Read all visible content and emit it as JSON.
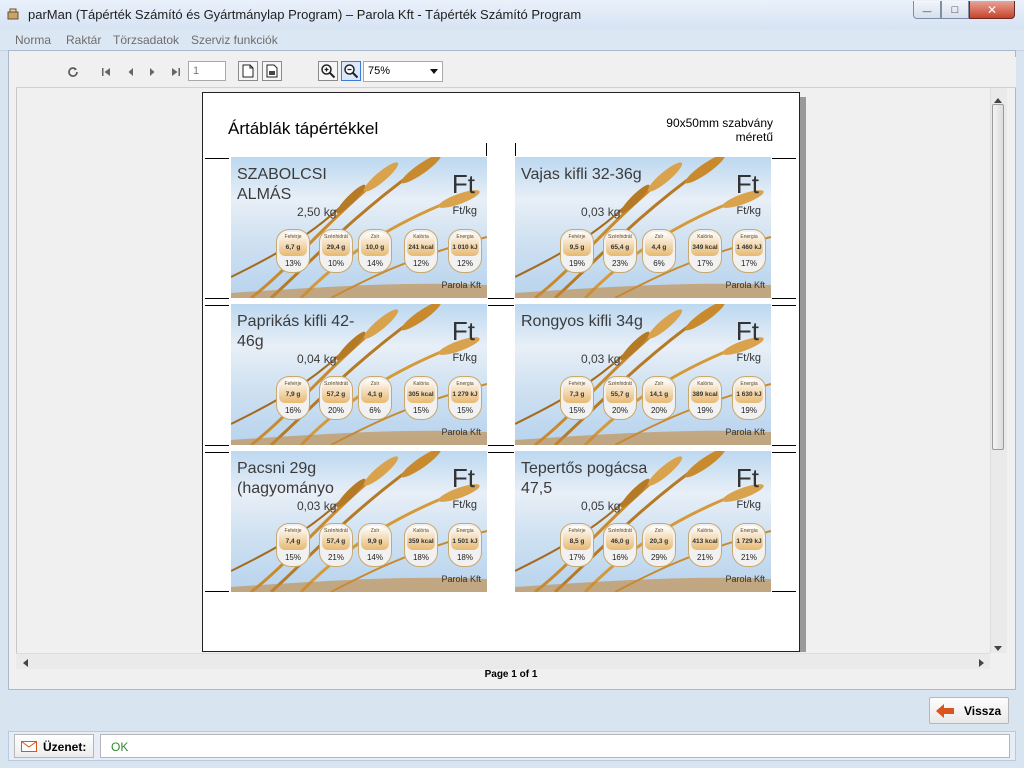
{
  "window": {
    "title": "parMan (Tápérték Számító és Gyártmánylap Program)    –    Parola Kft - Tápérték Számító Program",
    "minimize_glyph": "—",
    "maximize_glyph": "□",
    "close_glyph": "✕"
  },
  "menu": [
    "Norma",
    "Raktár",
    "Törzsadatok",
    "Szerviz funkciók"
  ],
  "toolbar": {
    "refresh_icon": "refresh-icon",
    "first_icon": "first-page-icon",
    "prev_icon": "prev-page-icon",
    "next_icon": "next-page-icon",
    "last_icon": "last-page-icon",
    "page_input": "1",
    "zoom_value": "75%"
  },
  "report": {
    "title": "Ártáblák tápértékkel",
    "note": "90x50mm szabvány méretű",
    "status": "Page 1 of 1"
  },
  "labels": [
    {
      "name": "SZABOLCSI ALMÁS",
      "price": "2,50  kg",
      "ft": "Ft",
      "ftkg": "Ft/kg",
      "firm": "Parola Kft",
      "nutrients": [
        {
          "label": "Fehérje",
          "value": "6,7 g",
          "pct": "13%"
        },
        {
          "label": "Szénhidrát",
          "value": "29,4 g",
          "pct": "10%"
        },
        {
          "label": "Zsír",
          "value": "10,0 g",
          "pct": "14%"
        },
        {
          "label": "Kalória",
          "value": "241 kcal",
          "pct": "12%"
        },
        {
          "label": "Energia",
          "value": "1 010 kJ",
          "pct": "12%"
        }
      ]
    },
    {
      "name": "Vajas kifli 32-36g",
      "price": "0,03  kg",
      "ft": "Ft",
      "ftkg": "Ft/kg",
      "firm": "Parola Kft",
      "nutrients": [
        {
          "label": "Fehérje",
          "value": "9,5 g",
          "pct": "19%"
        },
        {
          "label": "Szénhidrát",
          "value": "65,4 g",
          "pct": "23%"
        },
        {
          "label": "Zsír",
          "value": "4,4 g",
          "pct": "6%"
        },
        {
          "label": "Kalória",
          "value": "349 kcal",
          "pct": "17%"
        },
        {
          "label": "Energia",
          "value": "1 460 kJ",
          "pct": "17%"
        }
      ]
    },
    {
      "name": "Paprikás kifli 42-46g",
      "price": "0,04  kg",
      "ft": "Ft",
      "ftkg": "Ft/kg",
      "firm": "Parola Kft",
      "nutrients": [
        {
          "label": "Fehérje",
          "value": "7,9 g",
          "pct": "16%"
        },
        {
          "label": "Szénhidrát",
          "value": "57,2 g",
          "pct": "20%"
        },
        {
          "label": "Zsír",
          "value": "4,1 g",
          "pct": "6%"
        },
        {
          "label": "Kalória",
          "value": "305 kcal",
          "pct": "15%"
        },
        {
          "label": "Energia",
          "value": "1 279 kJ",
          "pct": "15%"
        }
      ]
    },
    {
      "name": "Rongyos kifli 34g",
      "price": "0,03  kg",
      "ft": "Ft",
      "ftkg": "Ft/kg",
      "firm": "Parola Kft",
      "nutrients": [
        {
          "label": "Fehérje",
          "value": "7,3 g",
          "pct": "15%"
        },
        {
          "label": "Szénhidrát",
          "value": "55,7 g",
          "pct": "20%"
        },
        {
          "label": "Zsír",
          "value": "14,1 g",
          "pct": "20%"
        },
        {
          "label": "Kalória",
          "value": "389 kcal",
          "pct": "19%"
        },
        {
          "label": "Energia",
          "value": "1 630 kJ",
          "pct": "19%"
        }
      ]
    },
    {
      "name": "Pacsni 29g (hagyományo",
      "price": "0,03  kg",
      "ft": "Ft",
      "ftkg": "Ft/kg",
      "firm": "Parola Kft",
      "nutrients": [
        {
          "label": "Fehérje",
          "value": "7,4 g",
          "pct": "15%"
        },
        {
          "label": "Szénhidrát",
          "value": "57,4 g",
          "pct": "21%"
        },
        {
          "label": "Zsír",
          "value": "9,9 g",
          "pct": "14%"
        },
        {
          "label": "Kalória",
          "value": "359 kcal",
          "pct": "18%"
        },
        {
          "label": "Energia",
          "value": "1 501 kJ",
          "pct": "18%"
        }
      ]
    },
    {
      "name": "Tepertős pogácsa 47,5",
      "price": "0,05  kg",
      "ft": "Ft",
      "ftkg": "Ft/kg",
      "firm": "Parola Kft",
      "nutrients": [
        {
          "label": "Fehérje",
          "value": "8,5 g",
          "pct": "17%"
        },
        {
          "label": "Szénhidrát",
          "value": "46,0 g",
          "pct": "16%"
        },
        {
          "label": "Zsír",
          "value": "20,3 g",
          "pct": "29%"
        },
        {
          "label": "Kalória",
          "value": "413 kcal",
          "pct": "21%"
        },
        {
          "label": "Energia",
          "value": "1 729 kJ",
          "pct": "21%"
        }
      ]
    }
  ],
  "actions": {
    "back_label": "Vissza"
  },
  "message": {
    "label": "Üzenet:",
    "text": "OK"
  },
  "colors": {
    "accent_orange": "#d9541e",
    "ok_green": "#2f8a2f",
    "wheat": "#c98a2e"
  }
}
